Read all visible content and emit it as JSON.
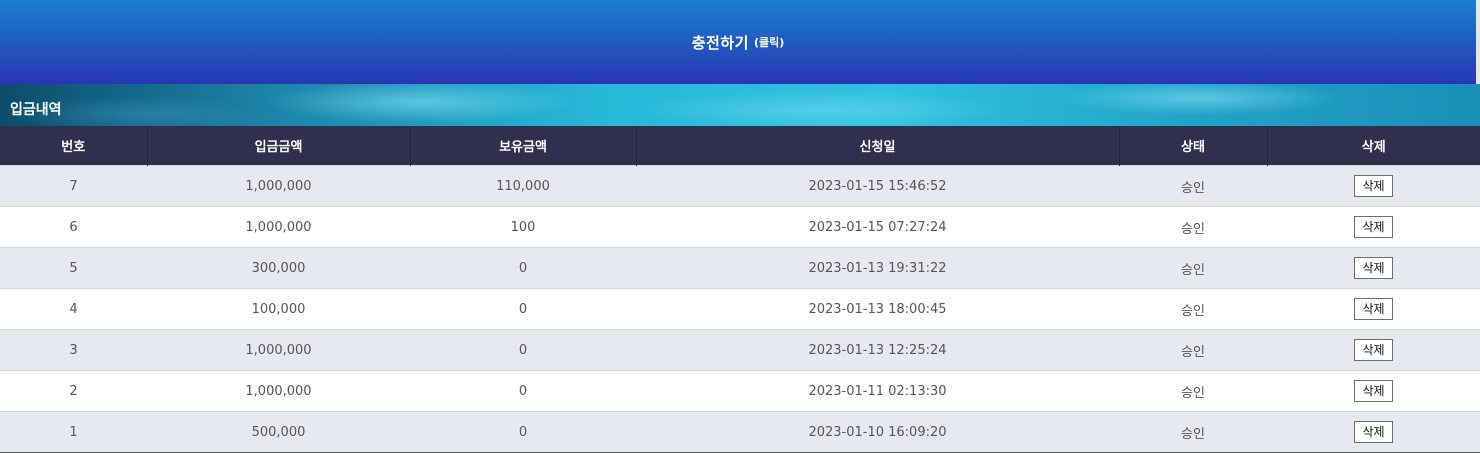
{
  "charge": {
    "title": "충전하기",
    "hint": "(클릭)"
  },
  "section": {
    "title": "입금내역"
  },
  "table": {
    "headers": [
      "번호",
      "입금금액",
      "보유금액",
      "신청일",
      "상태",
      "삭제"
    ],
    "rows": [
      {
        "no": "7",
        "deposit": "1,000,000",
        "balance": "110,000",
        "date": "2023-01-15 15:46:52",
        "status": "승인",
        "action": "삭제"
      },
      {
        "no": "6",
        "deposit": "1,000,000",
        "balance": "100",
        "date": "2023-01-15 07:27:24",
        "status": "승인",
        "action": "삭제"
      },
      {
        "no": "5",
        "deposit": "300,000",
        "balance": "0",
        "date": "2023-01-13 19:31:22",
        "status": "승인",
        "action": "삭제"
      },
      {
        "no": "4",
        "deposit": "100,000",
        "balance": "0",
        "date": "2023-01-13 18:00:45",
        "status": "승인",
        "action": "삭제"
      },
      {
        "no": "3",
        "deposit": "1,000,000",
        "balance": "0",
        "date": "2023-01-13 12:25:24",
        "status": "승인",
        "action": "삭제"
      },
      {
        "no": "2",
        "deposit": "1,000,000",
        "balance": "0",
        "date": "2023-01-11 02:13:30",
        "status": "승인",
        "action": "삭제"
      },
      {
        "no": "1",
        "deposit": "500,000",
        "balance": "0",
        "date": "2023-01-10 16:09:20",
        "status": "승인",
        "action": "삭제"
      }
    ]
  },
  "colors": {
    "banner_top": "#1c7fd0",
    "banner_bottom": "#2a35b4",
    "header_bg": "#30304e",
    "row_alt": "#e6e9f0"
  }
}
